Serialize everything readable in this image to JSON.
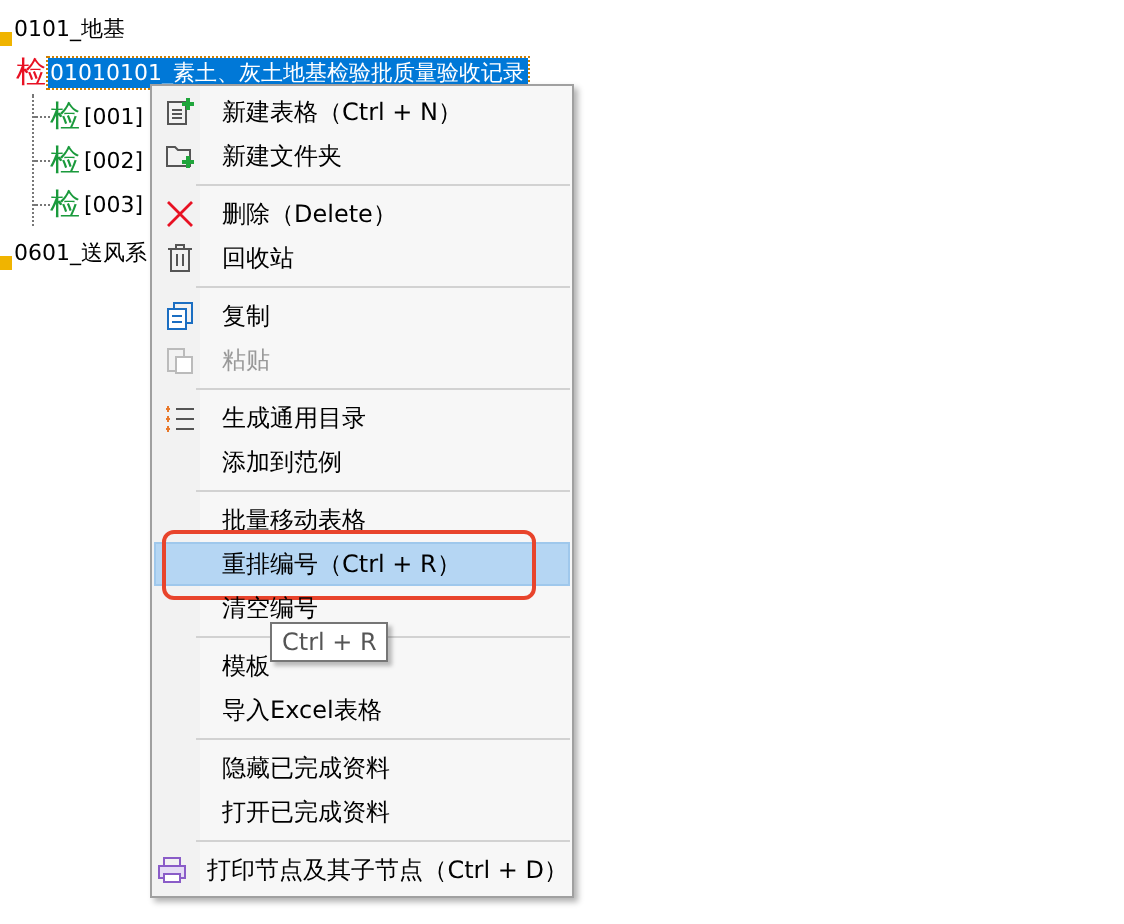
{
  "tree": [
    {
      "kind": "folder",
      "label": "0101_地基",
      "selected": false
    },
    {
      "kind": "form",
      "badge": "检",
      "color": "#e81123",
      "label": "01010101_素土、灰土地基检验批质量验收记录",
      "selected": true,
      "children": [
        {
          "kind": "form",
          "badge": "检",
          "color": "#1a9a3c",
          "label": "[001]",
          "selected": false
        },
        {
          "kind": "form",
          "badge": "检",
          "color": "#1a9a3c",
          "label": "[002]",
          "selected": false
        },
        {
          "kind": "form",
          "badge": "检",
          "color": "#1a9a3c",
          "label": "[003]",
          "selected": false
        }
      ]
    },
    {
      "kind": "folder",
      "label": "0601_送风系",
      "selected": false
    }
  ],
  "context_menu": {
    "sections": [
      [
        {
          "label": "新建表格（Ctrl + N）",
          "disabled": false,
          "selected": false
        },
        {
          "label": "新建文件夹",
          "disabled": false,
          "selected": false
        }
      ],
      [
        {
          "label": "删除（Delete）",
          "disabled": false,
          "selected": false
        },
        {
          "label": "回收站",
          "disabled": false,
          "selected": false
        }
      ],
      [
        {
          "label": "复制",
          "disabled": false,
          "selected": false
        },
        {
          "label": "粘贴",
          "disabled": true,
          "selected": false
        }
      ],
      [
        {
          "label": "生成通用目录",
          "disabled": false,
          "selected": false
        },
        {
          "label": "添加到范例",
          "disabled": false,
          "selected": false
        }
      ],
      [
        {
          "label": "批量移动表格",
          "disabled": false,
          "selected": false
        },
        {
          "label": "重排编号（Ctrl + R）",
          "disabled": false,
          "selected": true,
          "annotated": true
        },
        {
          "label": "清空编号",
          "disabled": false,
          "selected": false
        }
      ],
      [
        {
          "label": "模板",
          "disabled": false,
          "selected": false
        },
        {
          "label": "导入Excel表格",
          "disabled": false,
          "selected": false
        }
      ],
      [
        {
          "label": "隐藏已完成资料",
          "disabled": false,
          "selected": false
        },
        {
          "label": "打开已完成资料",
          "disabled": false,
          "selected": false
        }
      ],
      [
        {
          "label": "打印节点及其子节点（Ctrl + D）",
          "disabled": false,
          "selected": false
        }
      ]
    ]
  },
  "tooltip": {
    "text": "Ctrl + R"
  }
}
